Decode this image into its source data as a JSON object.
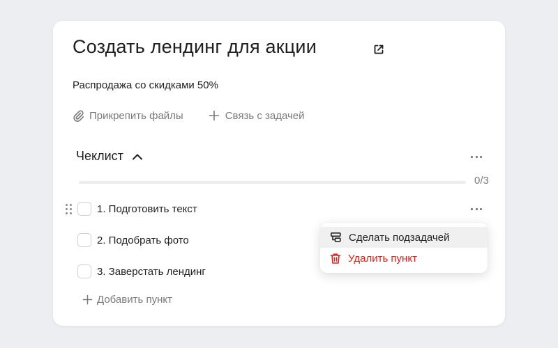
{
  "task": {
    "title": "Создать лендинг для акции",
    "description": "Распродажа со скидками 50%"
  },
  "actions": {
    "attach_label": "Прикрепить файлы",
    "link_label": "Связь с задачей"
  },
  "checklist": {
    "title": "Чеклист",
    "count": "0/3",
    "progress": 0,
    "items": [
      {
        "label": "1. Подготовить текст",
        "checked": false
      },
      {
        "label": "2. Подобрать фото",
        "checked": false
      },
      {
        "label": "3. Заверстать лендинг",
        "checked": false
      }
    ],
    "add_label": "Добавить пункт"
  },
  "context_menu": {
    "make_subtask_label": "Сделать подзадачей",
    "delete_label": "Удалить пункт"
  },
  "colors": {
    "danger": "#e0231b",
    "muted": "#7a7a7a"
  }
}
